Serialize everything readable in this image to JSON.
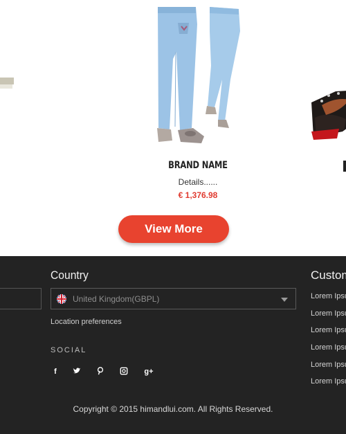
{
  "product": {
    "brand": "BRAND NAME",
    "details": "Details......",
    "price": "€ 1,376.98"
  },
  "cta": {
    "label": "View More"
  },
  "footer": {
    "country": {
      "title": "Country",
      "selected": "United Kingdom(GBPL)",
      "location_link": "Location preferences"
    },
    "social": {
      "title": "SOCIAL",
      "icons": [
        "facebook-icon",
        "twitter-icon",
        "pinterest-icon",
        "instagram-icon",
        "google-plus-icon"
      ]
    },
    "customer": {
      "title": "Customer",
      "items": [
        "Lorem Ipsum",
        "Lorem Ipsum",
        "Lorem Ipsum",
        "Lorem Ipsum",
        "Lorem Ipsum",
        "Lorem Ipsum"
      ]
    },
    "copyright": "Copyright © 2015 himandlui.com. All Rights Reserved."
  },
  "colors": {
    "accent": "#e8432f",
    "price": "#e03a2f",
    "footer_bg": "#232323"
  }
}
